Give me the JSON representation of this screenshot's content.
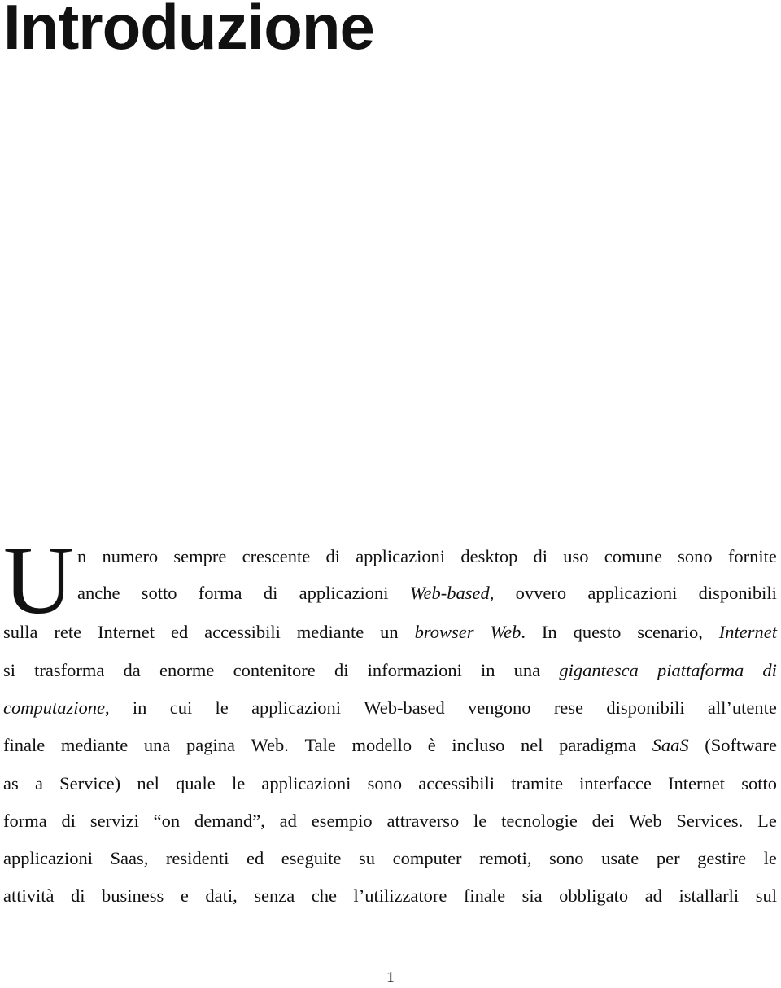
{
  "chapter": {
    "title": "Introduzione"
  },
  "paragraph": {
    "drop_cap": "U",
    "lines": [
      [
        {
          "t": "n numero sempre crescente di applicazioni desktop di uso comune sono fornite"
        }
      ],
      [
        {
          "t": "anche sotto forma di applicazioni "
        },
        {
          "t": "Web-based",
          "i": true
        },
        {
          "t": ", ovvero applicazioni disponibili"
        }
      ],
      [
        {
          "t": "sulla rete Internet ed accessibili mediante un "
        },
        {
          "t": "browser Web",
          "i": true
        },
        {
          "t": ". In questo scenario, "
        },
        {
          "t": "Internet",
          "i": true
        }
      ],
      [
        {
          "t": "si trasforma da enorme contenitore di informazioni in una "
        },
        {
          "t": "gigantesca piattaforma di",
          "i": true
        }
      ],
      [
        {
          "t": "computazione",
          "i": true
        },
        {
          "t": ", in cui le applicazioni Web-based vengono rese disponibili all’utente"
        }
      ],
      [
        {
          "t": "finale mediante una pagina Web. Tale modello è incluso nel paradigma "
        },
        {
          "t": "SaaS",
          "i": true
        },
        {
          "t": " (Software"
        }
      ],
      [
        {
          "t": "as a Service) nel quale le applicazioni sono accessibili tramite interfacce Internet sotto"
        }
      ],
      [
        {
          "t": "forma di servizi “on demand”, ad esempio attraverso le tecnologie dei Web Services. Le"
        }
      ],
      [
        {
          "t": "applicazioni Saas, residenti ed eseguite su computer remoti, sono usate per gestire le"
        }
      ],
      [
        {
          "t": "attività di business e dati, senza che l’utilizzatore finale sia obbligato ad istallarli sul"
        }
      ]
    ]
  },
  "footer": {
    "page_number": "1"
  }
}
